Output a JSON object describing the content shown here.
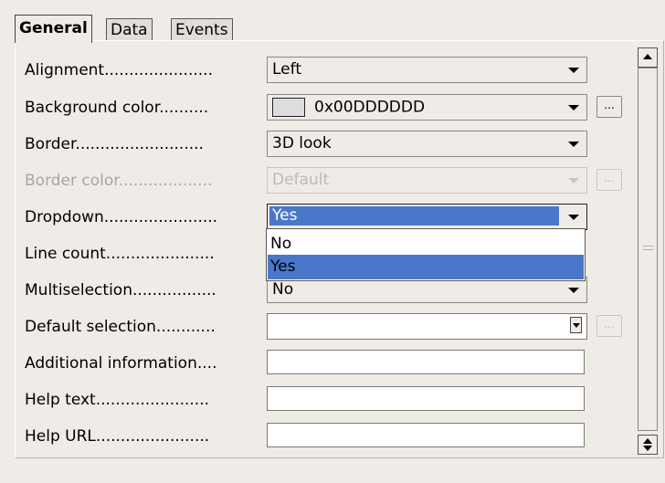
{
  "tabs": [
    {
      "label": "General"
    },
    {
      "label": "Data"
    },
    {
      "label": "Events"
    }
  ],
  "rows": [
    {
      "label": "Alignment......................",
      "value": "Left"
    },
    {
      "label": "Background color..........",
      "value": "0x00DDDDDD",
      "swatch_color": "#dddddd",
      "button": "..."
    },
    {
      "label": "Border..........................",
      "value": "3D look"
    },
    {
      "label": "Border color...................",
      "value": "Default",
      "button": "..."
    },
    {
      "label": "Dropdown.......................",
      "value": "Yes"
    },
    {
      "label": "Line count......................"
    },
    {
      "label": "Multiselection.................",
      "value": "No"
    },
    {
      "label": "Default selection............",
      "button": "..."
    },
    {
      "label": "Additional information...."
    },
    {
      "label": "Help text......................."
    },
    {
      "label": "Help URL......................."
    }
  ],
  "dropdown_popup": {
    "options": [
      "No",
      "Yes"
    ],
    "selected": "Yes"
  },
  "colors": {
    "highlight": "#4a77c9",
    "panel_bg": "#efebe7"
  }
}
